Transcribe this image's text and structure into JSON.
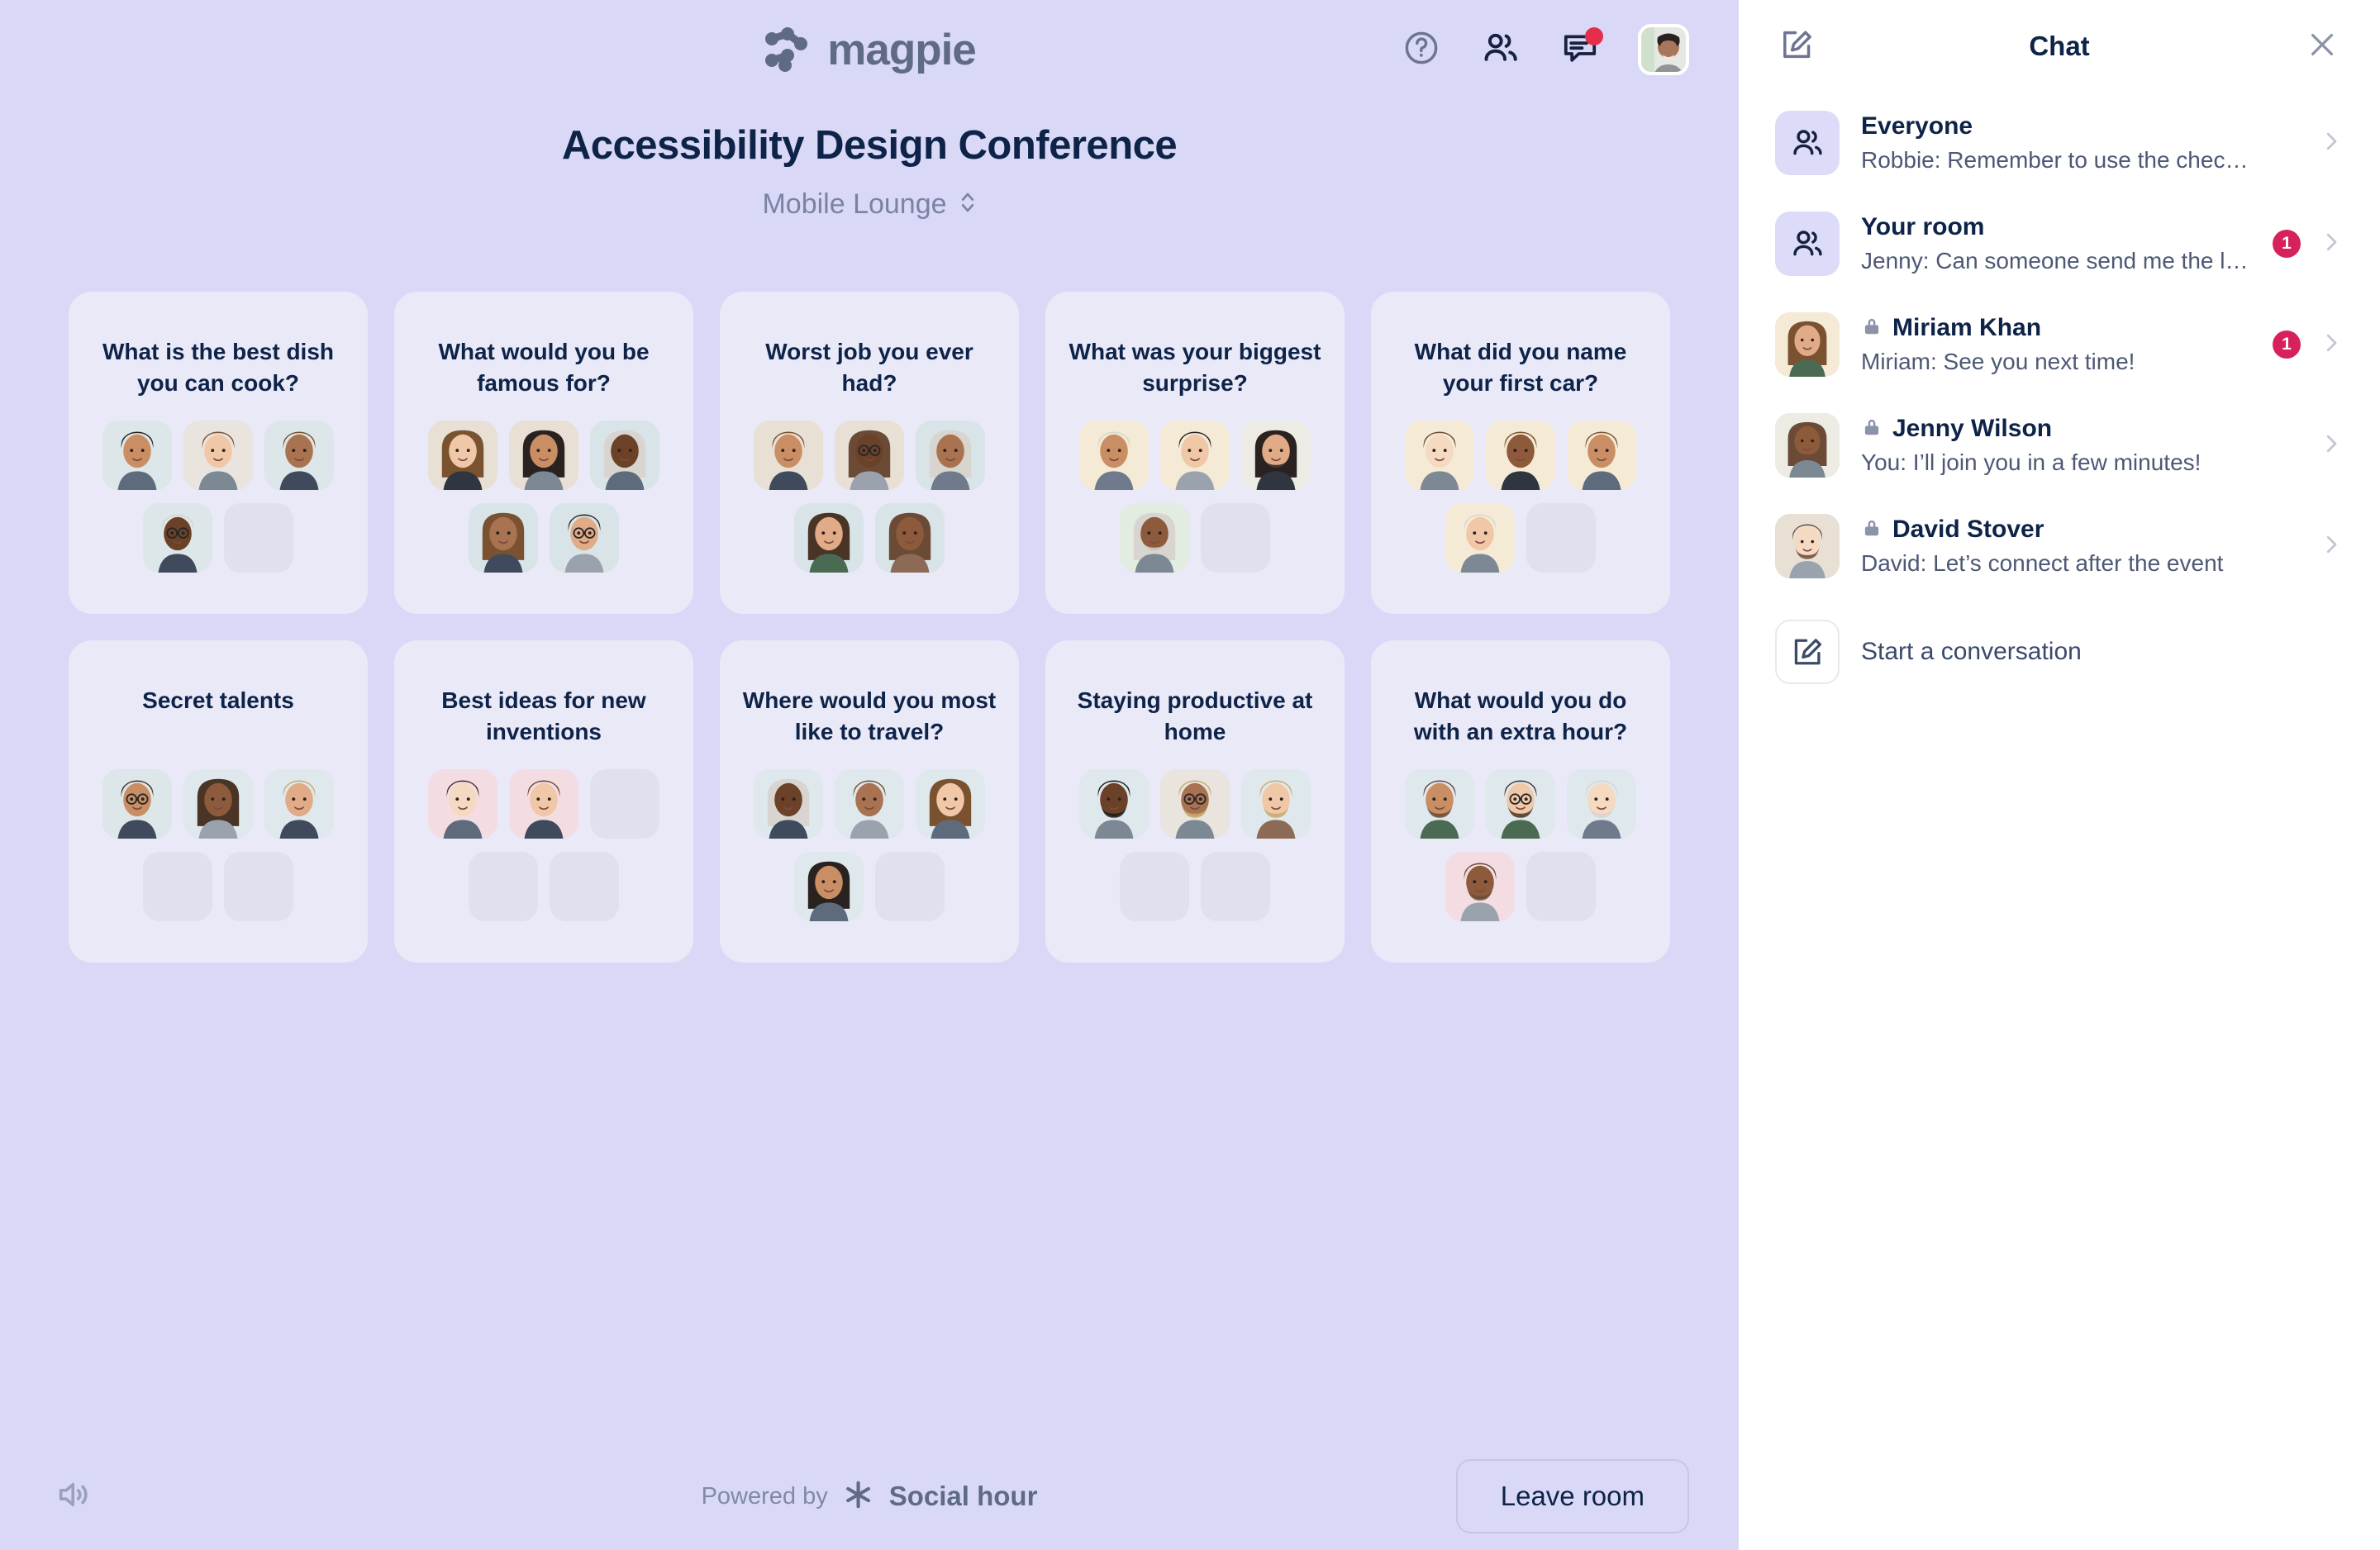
{
  "brand": {
    "logo_text": "magpie",
    "logo_color": "#5f6b85"
  },
  "header": {
    "help_icon": "question-circle-icon",
    "people_icon": "people-icon",
    "chat_icon": "chat-bubble-icon",
    "has_chat_notification": true,
    "avatar_icon": "user-avatar"
  },
  "event": {
    "title": "Accessibility Design Conference",
    "room_name": "Mobile Lounge",
    "room_selector_icon": "chevron-up-down-icon"
  },
  "tables": [
    {
      "title": "What is the best dish you can cook?",
      "occupied": 4,
      "empty": 1
    },
    {
      "title": "What would you be famous for?",
      "occupied": 5,
      "empty": 0
    },
    {
      "title": "Worst job you ever had?",
      "occupied": 5,
      "empty": 0
    },
    {
      "title": "What was your biggest surprise?",
      "occupied": 4,
      "empty": 1
    },
    {
      "title": "What did you name your first car?",
      "occupied": 4,
      "empty": 1
    },
    {
      "title": "Secret talents",
      "occupied": 3,
      "empty": 2
    },
    {
      "title": "Best ideas for new inventions",
      "occupied": 2,
      "empty": 3
    },
    {
      "title": "Where would you most like to travel?",
      "occupied": 4,
      "empty": 1
    },
    {
      "title": "Staying productive at home",
      "occupied": 3,
      "empty": 2
    },
    {
      "title": "What would you do with an extra hour?",
      "occupied": 4,
      "empty": 1
    }
  ],
  "footer": {
    "volume_icon": "speaker-volume-icon",
    "powered_by_label": "Powered by",
    "powered_by_name": "Social hour",
    "powered_by_icon": "asterisk-star-icon",
    "leave_label": "Leave room"
  },
  "chat": {
    "title": "Chat",
    "compose_icon": "compose-pencil-icon",
    "close_icon": "close-x-icon",
    "chevron_icon": "chevron-right-icon",
    "lock_icon": "lock-icon",
    "items": [
      {
        "name": "Everyone",
        "preview": "Robbie: Remember to use the checklist b...",
        "avatar_type": "group",
        "locked": false,
        "unread": ""
      },
      {
        "name": "Your room",
        "preview": "Jenny: Can someone send me the link?",
        "avatar_type": "group",
        "locked": false,
        "unread": "1"
      },
      {
        "name": "Miriam Khan",
        "preview": "Miriam: See you next time!",
        "avatar_type": "photo",
        "locked": true,
        "unread": "1"
      },
      {
        "name": "Jenny Wilson",
        "preview": "You: I’ll join you in a few minutes!",
        "avatar_type": "photo",
        "locked": true,
        "unread": ""
      },
      {
        "name": "David Stover",
        "preview": "David: Let’s connect after the event",
        "avatar_type": "photo",
        "locked": true,
        "unread": ""
      }
    ],
    "start_conversation_label": "Start a conversation",
    "start_conversation_icon": "compose-pencil-icon"
  },
  "colors": {
    "page_background": "#d9d9f7",
    "card_background": "#e9e9f8",
    "title_text": "#0e2348",
    "muted_text": "#7b82a3",
    "badge": "#d6215a",
    "notification": "#e52d4c",
    "panel_background": "#ffffff"
  }
}
